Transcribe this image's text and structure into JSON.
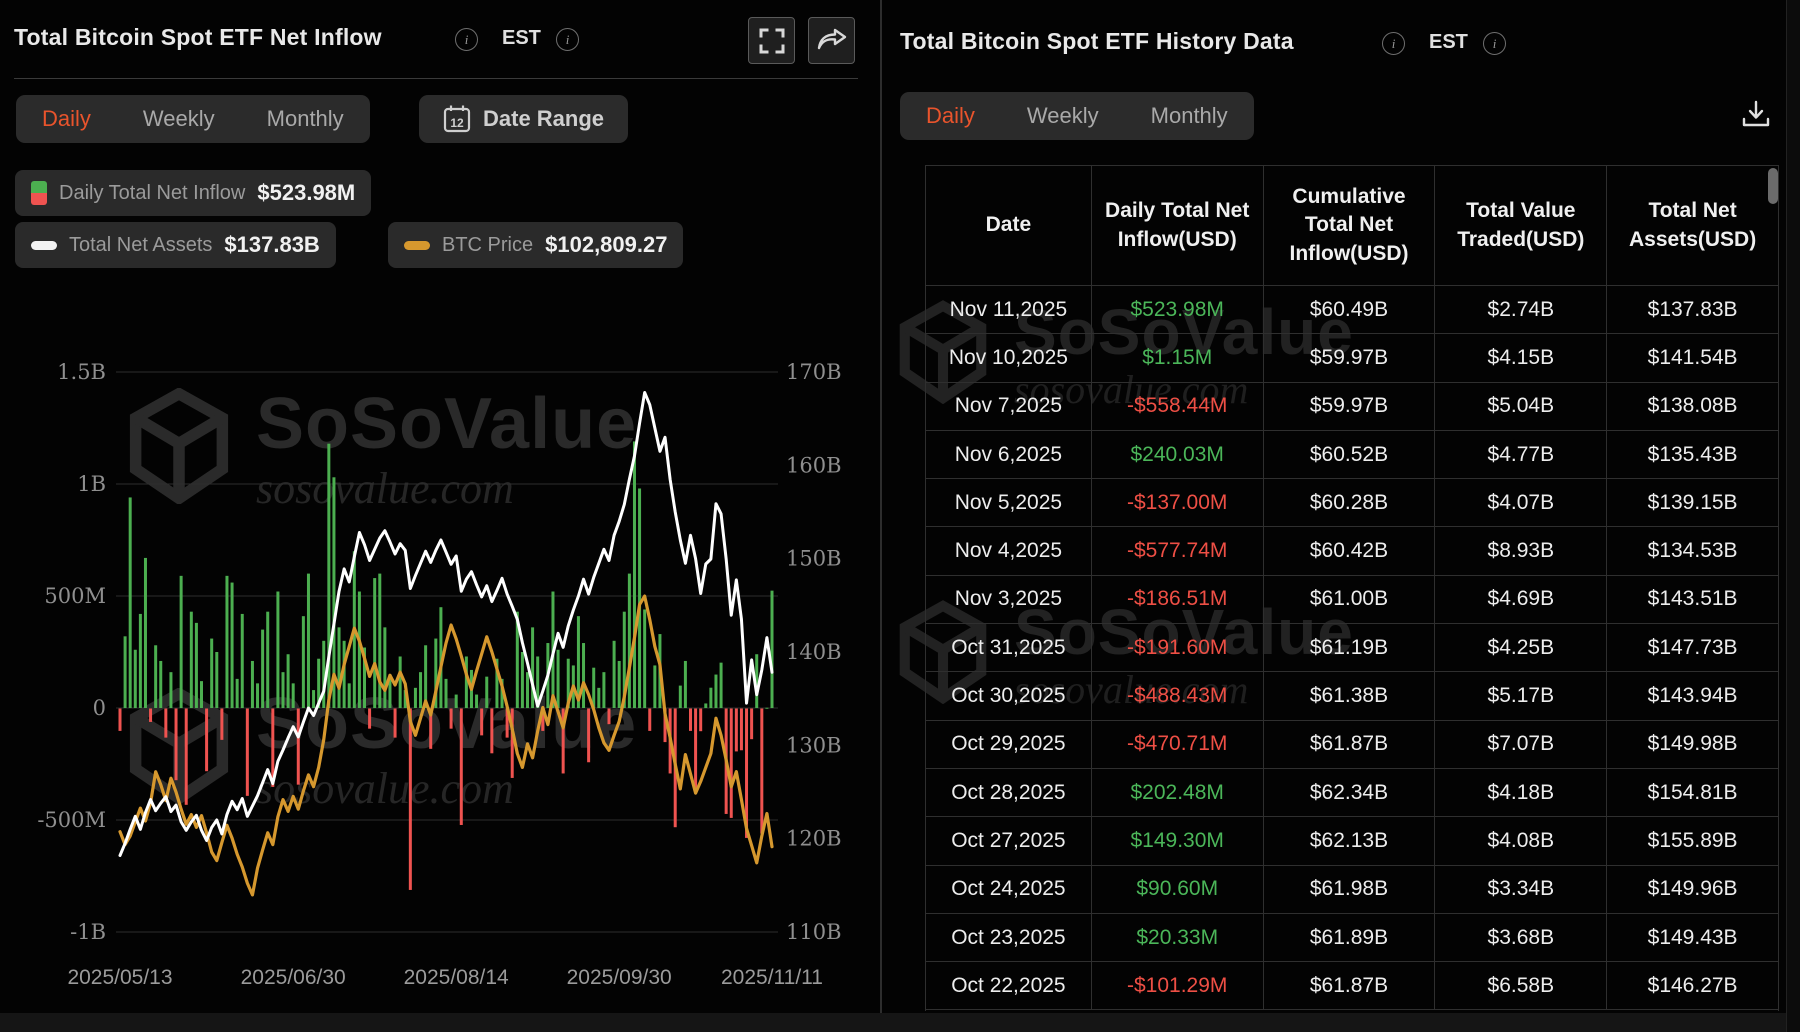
{
  "watermark": {
    "brand": "SoSoValue",
    "domain": "sosovalue.com"
  },
  "colors": {
    "accent_orange": "#e9542c",
    "bar_positive": "#4caf50",
    "bar_negative": "#ef5350",
    "assets_line": "#ffffff",
    "btc_line": "#d6982e",
    "table_positive": "#4bb659",
    "table_negative": "#ee4f45"
  },
  "left_panel": {
    "title": "Total Bitcoin Spot ETF Net Inflow",
    "est_label": "EST",
    "tabs": [
      "Daily",
      "Weekly",
      "Monthly"
    ],
    "active_tab": "Daily",
    "date_range_label": "Date Range",
    "calendar_icon_day": "12",
    "legend": {
      "inflow_label": "Daily Total Net Inflow",
      "inflow_value": "$523.98M",
      "assets_label": "Total Net Assets",
      "assets_value": "$137.83B",
      "btc_label": "BTC Price",
      "btc_value": "$102,809.27"
    }
  },
  "chart_data": {
    "type": "combo",
    "title": "Total Bitcoin Spot ETF Net Inflow (Daily)",
    "x_labels": [
      "2025/05/13",
      "2025/06/30",
      "2025/08/14",
      "2025/09/30",
      "2025/11/11"
    ],
    "left_axis": {
      "labels": [
        "1.5B",
        "1B",
        "500M",
        "0",
        "-500M",
        "-1B"
      ],
      "min_m": -1000,
      "max_m": 1500
    },
    "right_axis": {
      "labels": [
        "170B",
        "160B",
        "150B",
        "140B",
        "130B",
        "120B",
        "110B"
      ],
      "min_b": 110,
      "max_b": 170
    },
    "series": [
      {
        "name": "Daily Total Net Inflow",
        "type": "bar",
        "unit": "USD_M",
        "values": [
          -100,
          320,
          940,
          260,
          420,
          670,
          -60,
          280,
          210,
          -130,
          160,
          -320,
          590,
          -430,
          430,
          380,
          120,
          -280,
          310,
          250,
          -140,
          590,
          560,
          130,
          420,
          -390,
          210,
          110,
          350,
          430,
          -350,
          520,
          160,
          240,
          110,
          -340,
          410,
          600,
          80,
          220,
          300,
          1180,
          1030,
          360,
          300,
          110,
          700,
          520,
          270,
          -90,
          580,
          600,
          360,
          150,
          -130,
          230,
          80,
          -810,
          90,
          160,
          280,
          -180,
          310,
          450,
          130,
          -90,
          60,
          -520,
          230,
          170,
          60,
          -120,
          140,
          -200,
          220,
          130,
          -130,
          -310,
          430,
          250,
          160,
          360,
          230,
          -100,
          290,
          520,
          260,
          -290,
          220,
          190,
          410,
          290,
          -240,
          180,
          90,
          160,
          -70,
          300,
          210,
          430,
          600,
          1190,
          980,
          440,
          -100,
          190,
          330,
          -150,
          -290,
          -530,
          100,
          210,
          -100,
          -370,
          -101.29,
          20.33,
          90.6,
          149.3,
          202.48,
          -470.71,
          -488.43,
          -191.6,
          -186.51,
          -577.74,
          -137,
          240.03,
          -558.44,
          1.15,
          523.98
        ]
      },
      {
        "name": "Total Net Assets",
        "type": "line",
        "unit": "USD_B",
        "values": [
          118.2,
          119.5,
          121.0,
          122.4,
          121.0,
          122.8,
          124.2,
          123.0,
          123.8,
          124.5,
          122.9,
          123.6,
          121.8,
          120.9,
          121.8,
          122.5,
          120.9,
          119.8,
          121.2,
          122.0,
          120.5,
          122.6,
          124.0,
          123.1,
          124.3,
          122.4,
          123.5,
          124.6,
          126.0,
          127.4,
          125.9,
          128.3,
          129.5,
          130.8,
          132.0,
          130.9,
          132.5,
          134.0,
          133.2,
          134.5,
          135.8,
          139.5,
          143.0,
          146.5,
          148.9,
          147.5,
          150.2,
          152.8,
          151.5,
          149.8,
          151.0,
          152.2,
          153.0,
          151.8,
          150.5,
          151.6,
          150.9,
          146.8,
          148.2,
          149.5,
          150.8,
          149.6,
          150.9,
          152.0,
          150.7,
          149.4,
          150.3,
          146.5,
          147.8,
          148.6,
          147.2,
          145.9,
          147.1,
          145.4,
          146.6,
          147.9,
          146.2,
          144.9,
          143.5,
          141.0,
          138.8,
          136.5,
          134.2,
          135.8,
          137.5,
          139.8,
          142.0,
          140.5,
          142.8,
          144.5,
          146.0,
          147.8,
          146.2,
          148.0,
          149.5,
          151.0,
          149.8,
          152.5,
          154.0,
          155.8,
          158.5,
          161.0,
          164.5,
          167.8,
          166.5,
          164.0,
          161.5,
          163.0,
          158.5,
          155.0,
          152.0,
          149.5,
          152.5,
          150.0,
          146.27,
          149.43,
          149.96,
          155.89,
          154.81,
          149.98,
          143.94,
          147.73,
          143.51,
          134.53,
          139.15,
          135.43,
          138.08,
          141.54,
          137.83
        ]
      },
      {
        "name": "BTC Price",
        "type": "line",
        "unit": "USD_K",
        "values": [
          104.2,
          103.0,
          103.8,
          105.1,
          106.4,
          105.2,
          106.9,
          109.8,
          108.6,
          107.1,
          109.2,
          107.9,
          106.3,
          104.9,
          105.8,
          104.6,
          105.7,
          104.1,
          102.3,
          101.5,
          103.2,
          104.8,
          103.6,
          102.1,
          100.9,
          99.4,
          98.3,
          100.8,
          102.5,
          104.1,
          103.0,
          105.6,
          107.2,
          106.1,
          107.5,
          106.3,
          108.0,
          109.5,
          108.4,
          110.2,
          112.8,
          116.5,
          118.9,
          117.6,
          119.8,
          121.5,
          123.2,
          122.0,
          120.4,
          118.7,
          119.9,
          118.2,
          117.4,
          118.8,
          117.9,
          119.1,
          118.0,
          114.5,
          113.2,
          114.8,
          116.4,
          115.1,
          117.3,
          119.6,
          121.8,
          123.5,
          122.2,
          120.6,
          118.9,
          117.5,
          119.2,
          120.8,
          122.4,
          121.0,
          119.4,
          117.8,
          115.9,
          113.8,
          111.5,
          110.2,
          112.4,
          111.1,
          113.6,
          115.8,
          114.2,
          116.9,
          115.4,
          113.9,
          116.2,
          117.8,
          116.5,
          118.1,
          117.0,
          115.6,
          113.9,
          112.5,
          111.8,
          113.2,
          114.5,
          116.8,
          119.5,
          122.3,
          125.4,
          126.2,
          124.0,
          121.5,
          119.8,
          115.2,
          113.0,
          110.5,
          108.2,
          111.4,
          109.6,
          107.8,
          108.9,
          110.2,
          111.5,
          114.8,
          113.2,
          110.9,
          108.4,
          109.8,
          107.2,
          104.5,
          102.9,
          101.3,
          103.8,
          105.9,
          102.8
        ]
      }
    ],
    "latest": {
      "daily_net_inflow": "$523.98M",
      "total_net_assets": "$137.83B",
      "btc_price": "$102,809.27"
    }
  },
  "right_panel": {
    "title": "Total Bitcoin Spot ETF History Data",
    "est_label": "EST",
    "tabs": [
      "Daily",
      "Weekly",
      "Monthly"
    ],
    "active_tab": "Daily",
    "table": {
      "columns": [
        "Date",
        "Daily Total Net Inflow(USD)",
        "Cumulative Total Net Inflow(USD)",
        "Total Value Traded(USD)",
        "Total Net Assets(USD)"
      ],
      "rows": [
        {
          "date": "Nov 11,2025",
          "inflow": "$523.98M",
          "dir": "pos",
          "cumulative": "$60.49B",
          "traded": "$2.74B",
          "assets": "$137.83B"
        },
        {
          "date": "Nov 10,2025",
          "inflow": "$1.15M",
          "dir": "pos",
          "cumulative": "$59.97B",
          "traded": "$4.15B",
          "assets": "$141.54B"
        },
        {
          "date": "Nov 7,2025",
          "inflow": "-$558.44M",
          "dir": "neg",
          "cumulative": "$59.97B",
          "traded": "$5.04B",
          "assets": "$138.08B"
        },
        {
          "date": "Nov 6,2025",
          "inflow": "$240.03M",
          "dir": "pos",
          "cumulative": "$60.52B",
          "traded": "$4.77B",
          "assets": "$135.43B"
        },
        {
          "date": "Nov 5,2025",
          "inflow": "-$137.00M",
          "dir": "neg",
          "cumulative": "$60.28B",
          "traded": "$4.07B",
          "assets": "$139.15B"
        },
        {
          "date": "Nov 4,2025",
          "inflow": "-$577.74M",
          "dir": "neg",
          "cumulative": "$60.42B",
          "traded": "$8.93B",
          "assets": "$134.53B"
        },
        {
          "date": "Nov 3,2025",
          "inflow": "-$186.51M",
          "dir": "neg",
          "cumulative": "$61.00B",
          "traded": "$4.69B",
          "assets": "$143.51B"
        },
        {
          "date": "Oct 31,2025",
          "inflow": "-$191.60M",
          "dir": "neg",
          "cumulative": "$61.19B",
          "traded": "$4.25B",
          "assets": "$147.73B"
        },
        {
          "date": "Oct 30,2025",
          "inflow": "-$488.43M",
          "dir": "neg",
          "cumulative": "$61.38B",
          "traded": "$5.17B",
          "assets": "$143.94B"
        },
        {
          "date": "Oct 29,2025",
          "inflow": "-$470.71M",
          "dir": "neg",
          "cumulative": "$61.87B",
          "traded": "$7.07B",
          "assets": "$149.98B"
        },
        {
          "date": "Oct 28,2025",
          "inflow": "$202.48M",
          "dir": "pos",
          "cumulative": "$62.34B",
          "traded": "$4.18B",
          "assets": "$154.81B"
        },
        {
          "date": "Oct 27,2025",
          "inflow": "$149.30M",
          "dir": "pos",
          "cumulative": "$62.13B",
          "traded": "$4.08B",
          "assets": "$155.89B"
        },
        {
          "date": "Oct 24,2025",
          "inflow": "$90.60M",
          "dir": "pos",
          "cumulative": "$61.98B",
          "traded": "$3.34B",
          "assets": "$149.96B"
        },
        {
          "date": "Oct 23,2025",
          "inflow": "$20.33M",
          "dir": "pos",
          "cumulative": "$61.89B",
          "traded": "$3.68B",
          "assets": "$149.43B"
        },
        {
          "date": "Oct 22,2025",
          "inflow": "-$101.29M",
          "dir": "neg",
          "cumulative": "$61.87B",
          "traded": "$6.58B",
          "assets": "$146.27B"
        }
      ]
    }
  }
}
